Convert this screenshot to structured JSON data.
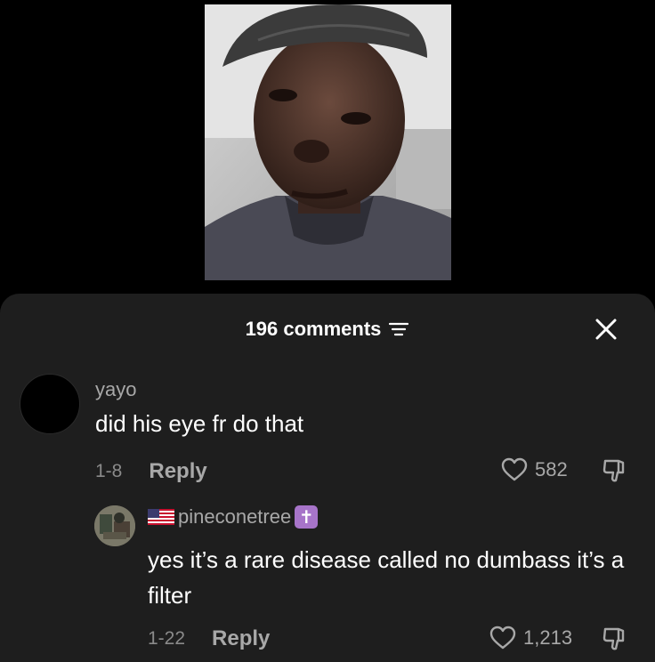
{
  "sheet": {
    "comments_count": "196 comments"
  },
  "comments": [
    {
      "username": "yayo",
      "text": "did his eye fr do that",
      "date": "1-8",
      "reply_label": "Reply",
      "likes": "582"
    },
    {
      "username": "pineconetree",
      "badge": "✝",
      "text": "yes it’s a rare disease called no dumbass it’s a filter",
      "date": "1-22",
      "reply_label": "Reply",
      "likes": "1,213"
    }
  ],
  "icons": {
    "sort": "sort-filter-icon",
    "close": "close-icon",
    "like": "heart-outline-icon",
    "dislike": "thumbs-down-icon",
    "flag": "us-flag-icon",
    "badge": "latin-cross-icon"
  },
  "colors": {
    "sheet_bg": "#1e1e1e",
    "page_bg": "#000000",
    "primary_text": "#ffffff",
    "secondary_text": "#a8a8a8",
    "badge_bg": "#a774c9"
  }
}
